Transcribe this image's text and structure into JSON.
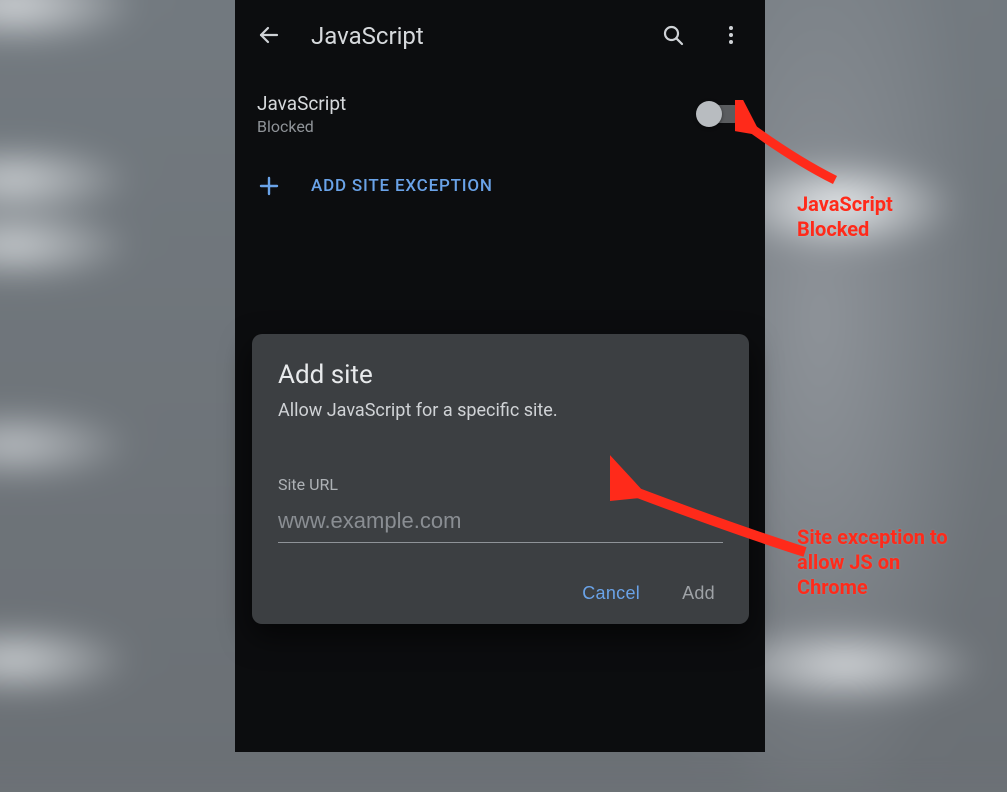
{
  "appbar": {
    "title": "JavaScript"
  },
  "setting": {
    "title": "JavaScript",
    "status": "Blocked",
    "toggle_on": false
  },
  "add_exception": {
    "label": "ADD SITE EXCEPTION"
  },
  "dialog": {
    "title": "Add site",
    "description": "Allow JavaScript for a specific site.",
    "field_label": "Site URL",
    "field_placeholder": "www.example.com",
    "cancel_label": "Cancel",
    "add_label": "Add"
  },
  "annotations": {
    "callout1": "JavaScript\nBlocked",
    "callout2": "Site exception to\nallow JS on\nChrome"
  },
  "colors": {
    "accent": "#6aa3e8",
    "annotation": "#ff2a1a"
  }
}
